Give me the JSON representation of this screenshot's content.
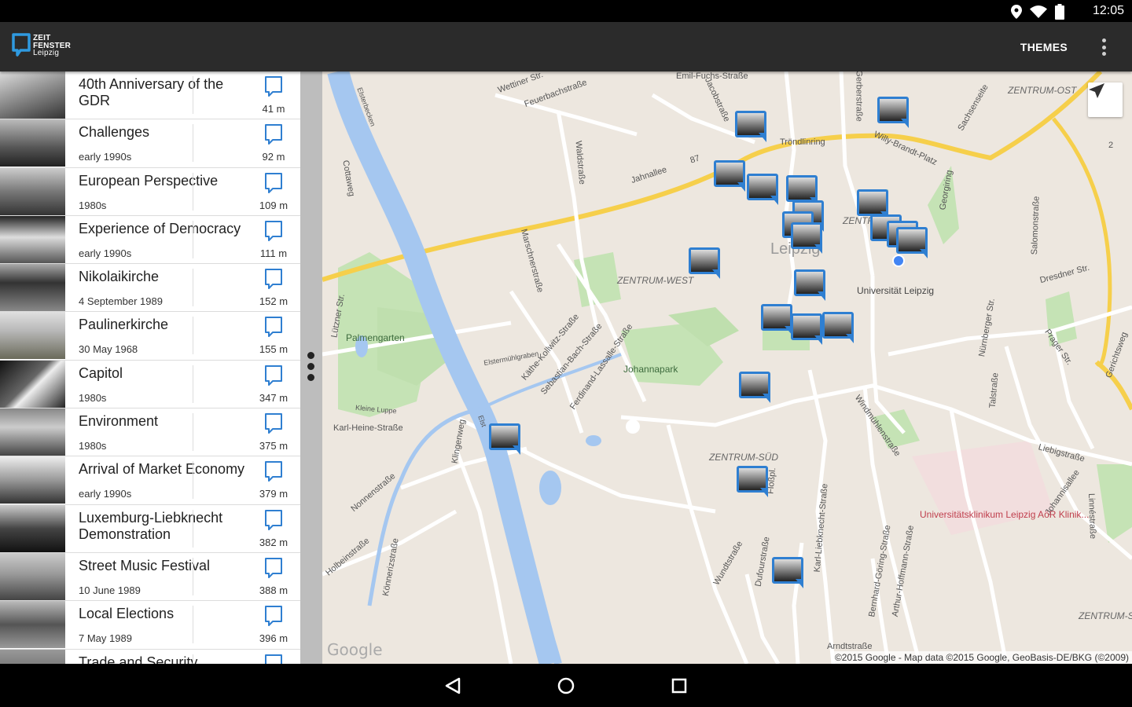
{
  "status": {
    "time": "12:05"
  },
  "app": {
    "logo_line1": "ZEIT",
    "logo_line2": "FENSTER",
    "logo_line3": "Leipzig",
    "themes_label": "THEMES"
  },
  "icons": {
    "location": "location-pin-icon",
    "wifi": "wifi-icon",
    "battery": "battery-icon",
    "overflow": "more-vert-icon",
    "comment": "comment-bubble-icon",
    "locate": "navigation-arrow-icon",
    "back": "back-triangle-icon",
    "home": "home-circle-icon",
    "recents": "recents-square-icon"
  },
  "colors": {
    "accent": "#2f7fd1",
    "appbar": "#2b2b2b",
    "motorway": "#f6cf4b",
    "water": "#a5c7f0",
    "park": "#c5e3b5"
  },
  "list": [
    {
      "title": "40th Anniversary of the GDR",
      "date": "",
      "distance": "41 m"
    },
    {
      "title": "Challenges",
      "date": "early 1990s",
      "distance": "92 m"
    },
    {
      "title": "European Perspective",
      "date": "1980s",
      "distance": "109 m"
    },
    {
      "title": "Experience of Democracy",
      "date": "early 1990s",
      "distance": "111 m"
    },
    {
      "title": "Nikolaikirche",
      "date": "4 September 1989",
      "distance": "152 m"
    },
    {
      "title": "Paulinerkirche",
      "date": "30 May 1968",
      "distance": "155 m"
    },
    {
      "title": "Capitol",
      "date": "1980s",
      "distance": "347 m"
    },
    {
      "title": "Environment",
      "date": "1980s",
      "distance": "375 m"
    },
    {
      "title": "Arrival of Market Economy",
      "date": "early 1990s",
      "distance": "379 m"
    },
    {
      "title": "Luxemburg-Liebknecht Demonstration",
      "date": "",
      "distance": "382 m"
    },
    {
      "title": "Street Music Festival",
      "date": "10 June 1989",
      "distance": "388 m"
    },
    {
      "title": "Local Elections",
      "date": "7 May 1989",
      "distance": "396 m"
    },
    {
      "title": "Trade and Security",
      "date": "",
      "distance": ""
    }
  ],
  "map": {
    "labels": {
      "wettiner": "Wettiner Str.",
      "feuerbach": "Feuerbachstraße",
      "emil": "Emil-Fuchs-Straße",
      "jacob": "Jacobstraße",
      "gerber": "Gerberstraße",
      "zentrum_ost": "ZENTRUM-OST",
      "sachsen": "Sachsenseite",
      "troendlin": "Tröndlinring",
      "willy": "Willy-Brandt-Platz",
      "jahnallee": "Jahnallee",
      "road87": "87",
      "road2": "2",
      "cotta": "Cottaweg",
      "waldstr": "Waldstraße",
      "elsterbecken": "Elsterbecken",
      "lutzner": "Lützner Str.",
      "marsch": "Marschnerstraße",
      "zentrum_west": "ZENTRUM-WEST",
      "leipzig": "Leipzig",
      "zentrum": "ZENTR",
      "georgi": "Georgiring",
      "salomon": "Salomonstraße",
      "dresdner": "Dresdner Str.",
      "uni": "Universität Leipzig",
      "palmengarten": "Palmengarten",
      "kathe": "Käthe-Kollwitz-Straße",
      "sebastian": "Sebastian-Bach-Straße",
      "ferdinand": "Ferdinand-Lassalle-Straße",
      "johannapark": "Johannapark",
      "elstermuehl": "Elstermühlgraben",
      "nurnberger": "Nürnberger Str.",
      "prager": "Prager Str.",
      "gerichts": "Gerichtsweg",
      "talstr": "Talstraße",
      "kleine_luppe": "Kleine Luppe",
      "karl_heine": "Karl-Heine-Straße",
      "klingen": "Klingenweg",
      "windmuehlen": "Windmühlenstraße",
      "zentrum_sued": "ZENTRUM-SÜD",
      "liebig": "Liebigstraße",
      "johannis": "Johannisallee",
      "linne": "Linnéstraße",
      "nonnen": "Nonnenstraße",
      "klinikum": "Universitätsklinikum Leipzig AöR Klinik...",
      "holbein": "Holbeinstraße",
      "koenner": "Könnerizstraße",
      "wundt": "Wundtstraße",
      "dufour": "Dufourstraße",
      "karl_lieb": "Karl-Liebknecht-Straße",
      "bernhard": "Bernhard-Göring-Straße",
      "arthur": "Arthur-Hoffmann-Straße",
      "zentrum_suedost": "ZENTRUM-SÜ",
      "arndt": "Arndtstraße",
      "floss": "Floßpl.",
      "elster": "Elst"
    },
    "google": "Google",
    "copyright": "©2015 Google - Map data ©2015 Google, GeoBasis-DE/BKG (©2009)"
  }
}
